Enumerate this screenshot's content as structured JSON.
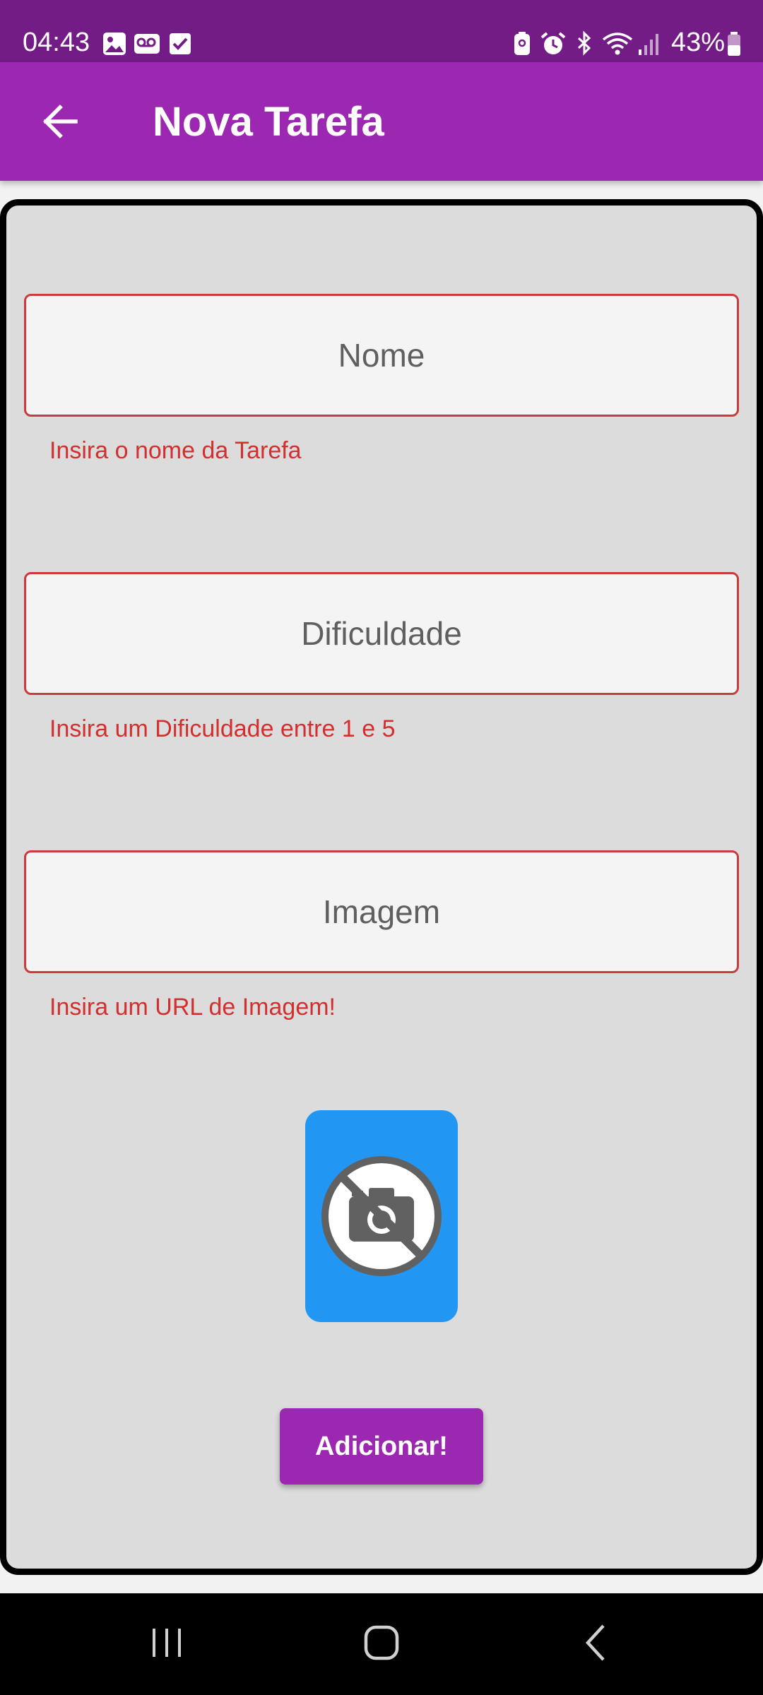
{
  "status_bar": {
    "time": "04:43",
    "battery": "43%",
    "icons": [
      "image-notification-icon",
      "voicemail-icon",
      "checkbox-icon",
      "battery-saver-icon",
      "alarm-icon",
      "bluetooth-icon",
      "wifi-icon",
      "signal-icon",
      "battery-icon"
    ]
  },
  "app_bar": {
    "title": "Nova Tarefa",
    "back_icon": "arrow-back-icon"
  },
  "form": {
    "fields": [
      {
        "placeholder": "Nome",
        "error": "Insira o nome da Tarefa"
      },
      {
        "placeholder": "Dificuldade",
        "error": "Insira um Dificuldade entre 1 e 5"
      },
      {
        "placeholder": "Imagem",
        "error": "Insira um URL de Imagem!"
      }
    ],
    "image_placeholder_icon": "no-photo-icon",
    "submit_label": "Adicionar!"
  },
  "nav_bar": {
    "buttons": [
      "recents-icon",
      "home-icon",
      "back-icon"
    ]
  },
  "colors": {
    "status_bar": "#741c85",
    "app_bar": "#9c27b0",
    "card": "#dcdcdc",
    "field_bg": "#f4f4f4",
    "error": "#d32f2f",
    "image_preview": "#2196f3",
    "button": "#9c27b0"
  }
}
